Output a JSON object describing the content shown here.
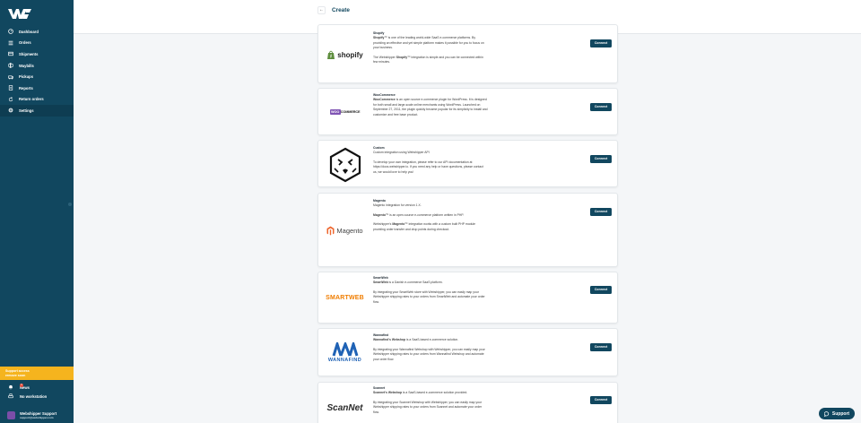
{
  "sidebar": {
    "items": [
      {
        "label": "Dashboard",
        "icon": "dashboard-icon"
      },
      {
        "label": "Orders",
        "icon": "orders-icon"
      },
      {
        "label": "Shipments",
        "icon": "shipments-icon"
      },
      {
        "label": "Waybills",
        "icon": "waybills-icon"
      },
      {
        "label": "Pickups",
        "icon": "pickups-icon"
      },
      {
        "label": "Reports",
        "icon": "reports-icon"
      },
      {
        "label": "Return orders",
        "icon": "return-orders-icon"
      },
      {
        "label": "Settings",
        "icon": "settings-icon",
        "active": true
      }
    ],
    "promo": {
      "line1": "Support access",
      "line2": "remove soon"
    },
    "news_label": "News",
    "news_count": "1",
    "workstation_label": "No workstation",
    "user_name": "Webshipper Support",
    "user_email": "support@webshipper.com"
  },
  "header": {
    "back": "←",
    "title": "Create"
  },
  "cards": [
    {
      "name": "shopify",
      "logo_text": "shopify",
      "title": "Shopify",
      "p1_bold": "Shopify™",
      "p1": " is one of the leading world-wide SaaS e-commerce platforms. By providing an effective and yet simple platform makes it possible for you to focus on your business.",
      "p2_pre": "The Webshipper ",
      "p2_bold": "Shopify™",
      "p2": " integration is simple and you can be connected within few minutes.",
      "button": "Connect"
    },
    {
      "name": "woocommerce",
      "logo_text": "WOOCOMMERCE",
      "title": "WooCommerce",
      "p1_bold": "WooCommerce",
      "p1": " is an open source e-commerce plugin for WordPress. It is designed for both small and large-scale online merchants using WordPress. Launched on September 27, 2011, the plugin quickly became popular for its simplicity to install and customize and free base product.",
      "button": "Connect"
    },
    {
      "name": "custom",
      "title": "Custom",
      "p1": "Custom integration using Webshipper API",
      "p2": "To develop your own integration, please refer to our API documentation at https://docs.webshipper.io. If you need any help or have questions, please contact us, we would love to help you!",
      "button": "Connect"
    },
    {
      "name": "magento",
      "logo_text": "Magento",
      "title": "Magento",
      "p1": "Magento integration for version 1.X.",
      "p2_bold": "Magento™",
      "p2": " is an open-source e-commerce platform written in PHP.",
      "p3_pre": "Webshipper's ",
      "p3_bold": "Magento™",
      "p3": " integration works with a custom built PHP module providing order transfer and drop points during checkout.",
      "button": "Connect"
    },
    {
      "name": "smartweb",
      "logo_text": "SMARTWEB",
      "title": "SmartWeb",
      "p1_bold": "SmartWeb",
      "p1": " is a Danish e-commerce SaaS platform.",
      "p2": "By integrating your SmartWeb store with Webshipper, you can easily map your Webshipper shipping rates to your orders from SmartWeb and automate your order flow.",
      "button": "Connect"
    },
    {
      "name": "wannafind",
      "logo_text": "WANNAFIND",
      "title": "Wannafind",
      "p1_bold": "Wannafind's Webshop",
      "p1": " is a SaaS-based e-commerce solution.",
      "p2": "By integrating your Wannafind Webshop with Webshipper, you can easily map your Webshipper shipping rates to your orders from Wannafind Webshop and automate your order flow.",
      "button": "Connect"
    },
    {
      "name": "scannet",
      "logo_text": "ScanNet",
      "title": "Scannet",
      "p1_bold": "Scannet's Webshop",
      "p1": " is a SaaS-based e-commerce solution provided.",
      "p2": "By integrating your Scannet Webshop with Webshipper, you can easily map your Webshipper shipping rates to your orders from Scannet and automate your order flow.",
      "button": "Connect"
    }
  ],
  "support": {
    "label": "Support"
  },
  "colors": {
    "sidebar": "#11475f",
    "accent": "#11475f",
    "promo": "#f5b41e",
    "background": "#f4f6f8"
  }
}
